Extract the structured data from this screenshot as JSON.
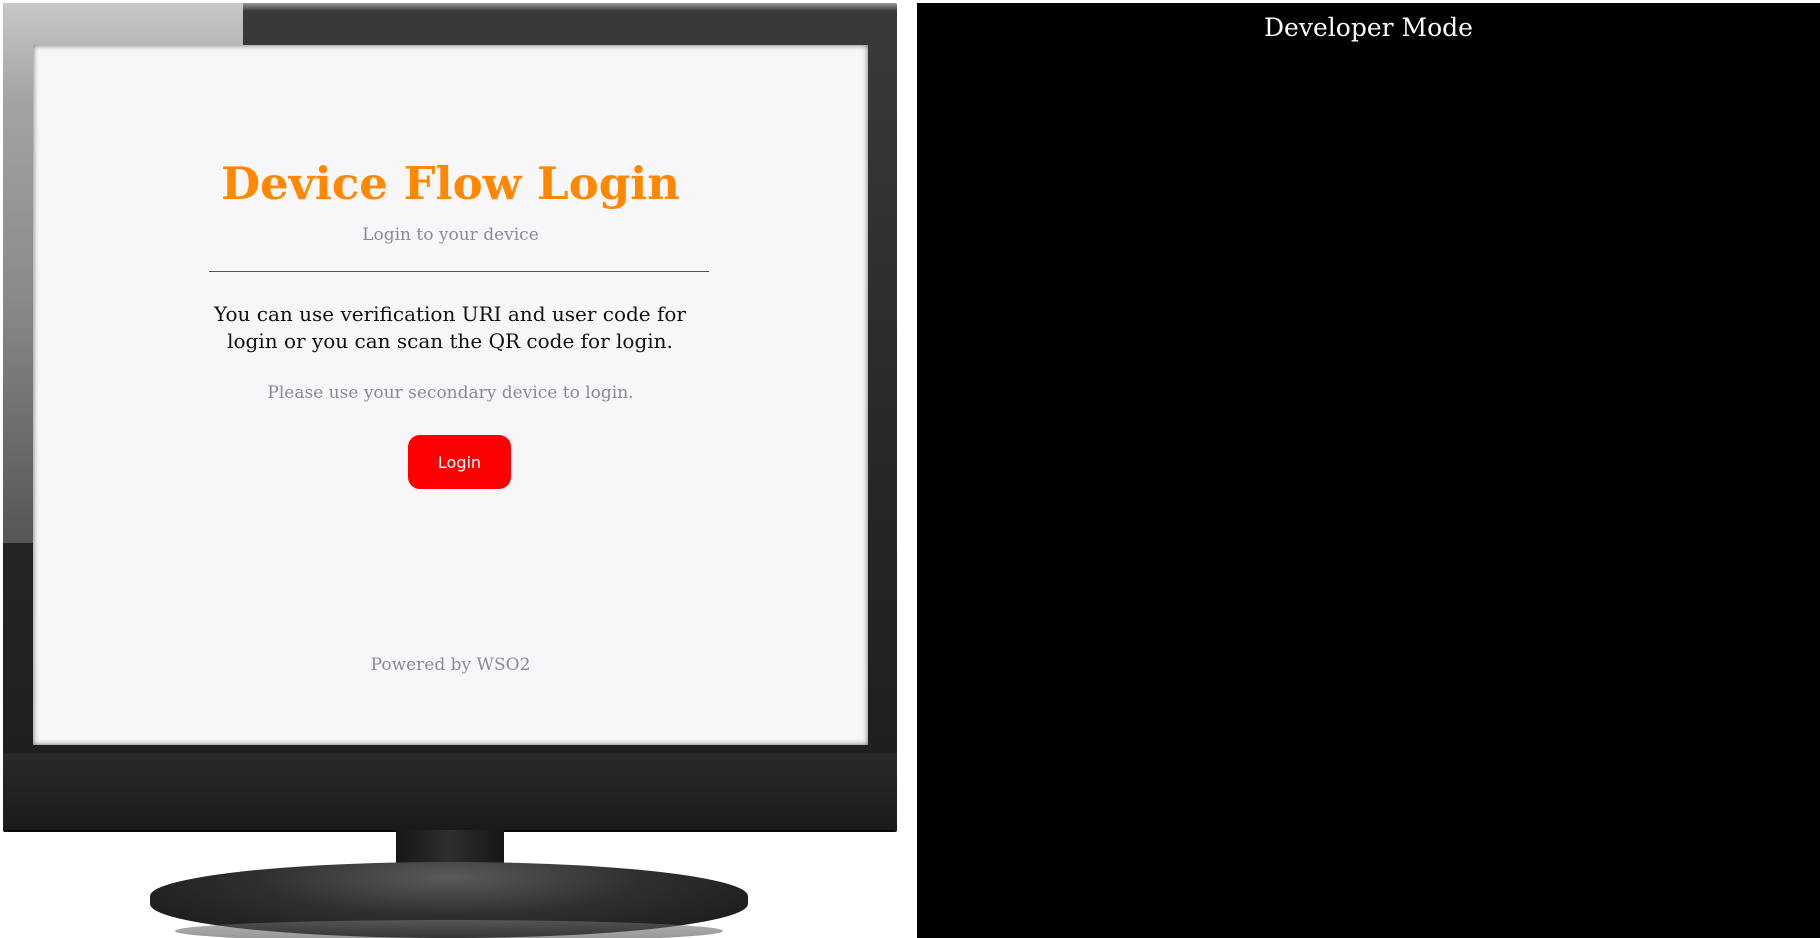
{
  "device_screen": {
    "title": "Device Flow Login",
    "subtitle": "Login to your device",
    "instructions": "You can use verification URI and user code for login or you can scan the QR code for login.",
    "note": "Please use your secondary device to login.",
    "login_button_label": "Login",
    "footer": "Powered by WSO2"
  },
  "developer_panel": {
    "title": "Developer Mode"
  },
  "colors": {
    "title": "#ff8800",
    "login_button": "#ff0000",
    "muted_text": "#8a8a99",
    "screen_background": "#f7f7f9",
    "developer_background": "#000000"
  }
}
